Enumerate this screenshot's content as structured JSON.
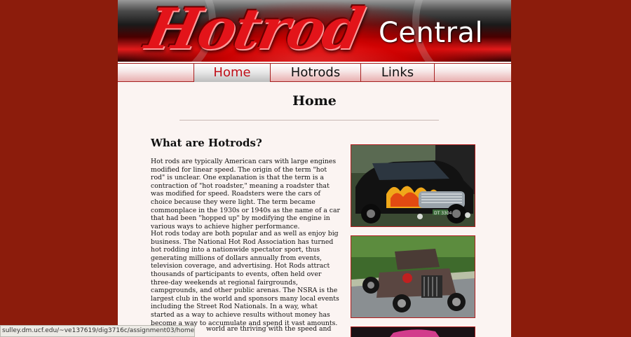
{
  "site": {
    "logo_script": "Hotrod",
    "logo_sub": "Central"
  },
  "nav": {
    "items": [
      {
        "label": "Home",
        "active": true
      },
      {
        "label": "Hotrods",
        "active": false
      },
      {
        "label": "Links",
        "active": false
      }
    ]
  },
  "page": {
    "heading": "Home",
    "section_title": "What are Hotrods?",
    "paragraph_1": "Hot rods are typically American cars with large engines modified for linear speed. The origin of the term \"hot rod\" is unclear. One explanation is that the term is a contraction of \"hot roadster,\" meaning a roadster that was modified for speed. Roadsters were the cars of choice because they were light. The term became commonplace in the 1930s or 1940s as the name of a car that had been \"hopped up\" by modifying the engine in various ways to achieve higher performance.",
    "paragraph_2": "Hot rods today are both popular and as well as enjoy big business. The National Hot Rod Association has turned hot rodding into a nationwide spectator sport, thus generating millions of dollars annually from events, television coverage, and advertising. Hot Rods attract thousands of participants to events, often held over three-day weekends at regional fairgrounds, campgrounds, and other public arenas. The NSRA is the largest club in the world and sponsors many local events including the Street Rod Nationals. In a way, what started as a way to achieve results without money has become a way to accumulate and spend it vast amounts.",
    "paragraph_3_partial": "world are thriving with the speed and"
  },
  "photos": [
    {
      "label": "black flame hotrod photo",
      "plate_text": "DT 3304"
    },
    {
      "label": "rat rod roadster photo"
    },
    {
      "label": "pink hotrod photo"
    }
  ],
  "status_bar": {
    "url": "sulley.dm.ucf.edu/~ve137619/dig3716c/assignment03/home.html"
  },
  "colors": {
    "background": "#8c1c0c",
    "accent_red": "#c0101a",
    "content_bg": "#fbf4f2"
  }
}
